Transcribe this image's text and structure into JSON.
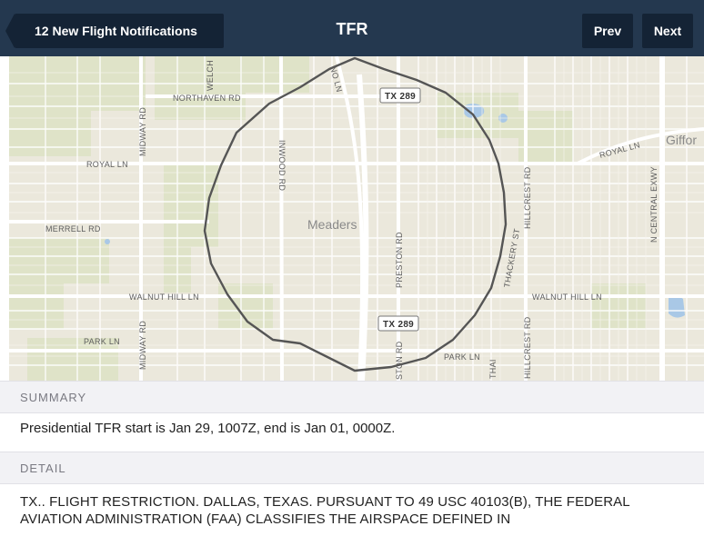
{
  "header": {
    "back_label": "12 New Flight Notifications",
    "title": "TFR",
    "prev_label": "Prev",
    "next_label": "Next",
    "bar_color": "#24384f",
    "button_color": "#142335"
  },
  "map": {
    "place_names": {
      "meaders": "Meaders",
      "gifford": "Giffor"
    },
    "road_labels": {
      "northaven": "NORTHAVEN RD",
      "royal_west": "ROYAL LN",
      "royal_east": "ROYAL LN",
      "merrell": "MERRELL RD",
      "walnut_hill_west": "WALNUT HILL LN",
      "walnut_hill_east": "WALNUT HILL LN",
      "park_west": "PARK LN",
      "park_east": "PARK LN",
      "midway_north": "MIDWAY RD",
      "midway_south": "MIDWAY RD",
      "inwood": "INWOOD RD",
      "preston": "PRESTON RD",
      "preston_south": "STON RD",
      "hillcrest": "HILLCREST RD",
      "hillcrest_south": "HILLCREST RD",
      "thackery": "THACKERY ST",
      "central": "N CENTRAL EXWY",
      "welch": "WELCH",
      "north_ln": "NO LN",
      "thai": "THAI",
      "tx289_north": "TX 289",
      "tx289_south": "TX 289"
    },
    "tfr_outline_color": "#555555"
  },
  "summary": {
    "header": "SUMMARY",
    "text": "Presidential TFR start is Jan 29, 1007Z, end is Jan 01, 0000Z."
  },
  "detail": {
    "header": "DETAIL",
    "text": "TX.. FLIGHT RESTRICTION. DALLAS, TEXAS. PURSUANT TO 49 USC 40103(B), THE FEDERAL AVIATION ADMINISTRATION (FAA) CLASSIFIES THE AIRSPACE DEFINED IN"
  }
}
